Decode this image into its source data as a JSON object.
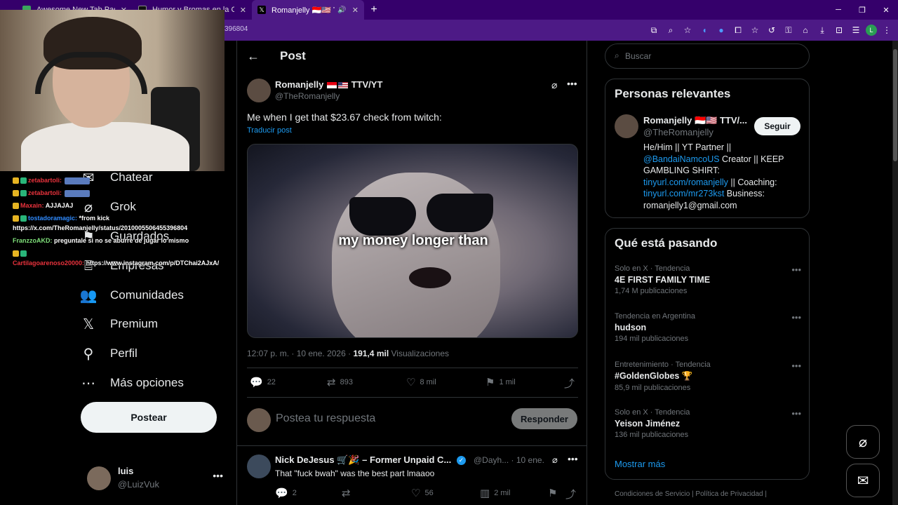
{
  "browser": {
    "tabs": [
      {
        "title": "Awesome New Tab Page",
        "active": false
      },
      {
        "title": "Humor y Bromas en la Calle co",
        "active": false
      },
      {
        "title": "Romanjelly 🇮🇩🇺🇸 TTV/YT en",
        "active": true
      }
    ],
    "url_fragment": "396804",
    "profile_initial": "L",
    "accent": "#4d1a86"
  },
  "chat": [
    {
      "user": "zetabartoli:",
      "text": "",
      "user_color": "red"
    },
    {
      "user": "zetabartoli:",
      "text": "",
      "user_color": "red"
    },
    {
      "user": "Maxain:",
      "text": "AJJAJAJ",
      "user_color": "red"
    },
    {
      "user": "tostadoramagic:",
      "text": "*from kick https://x.com/TheRomanjelly/status/2010005506455396804",
      "user_color": "blue"
    },
    {
      "user": "FranzzoAKD:",
      "text": "preguntale si no se aburre de jugar lo mismo",
      "user_color": "green"
    },
    {
      "user": "Cartilagoarenoso20000:",
      "text": "https://www.instagram.com/p/DTChai2AJxA/",
      "user_color": "red"
    }
  ],
  "nav": {
    "items": [
      {
        "label": "Chatear",
        "icon": "chat-icon"
      },
      {
        "label": "Grok",
        "icon": "grok-icon"
      },
      {
        "label": "Guardados",
        "icon": "bookmark-icon"
      },
      {
        "label": "Empresas",
        "icon": "briefcase-icon"
      },
      {
        "label": "Comunidades",
        "icon": "communities-icon"
      },
      {
        "label": "Premium",
        "icon": "x-logo-icon"
      },
      {
        "label": "Perfil",
        "icon": "person-icon"
      },
      {
        "label": "Más opciones",
        "icon": "more-circle-icon"
      }
    ],
    "post_button": "Postear",
    "account": {
      "name": "luis",
      "handle": "@LuizVuk"
    }
  },
  "main": {
    "header_title": "Post",
    "tweet": {
      "author_name": "Romanjelly",
      "author_suffix": "TTV/YT",
      "author_handle": "@TheRomanjelly",
      "text": "Me when I get that $23.67 check from twitch:",
      "translate": "Traducir post",
      "media_caption": "my money longer than",
      "time": "12:07 p. m. · 10 ene. 2026 ·",
      "views": "191,4 mil",
      "views_label": "Visualizaciones",
      "replies": "22",
      "reposts": "893",
      "likes": "8 mil",
      "bookmarks": "1 mil"
    },
    "reply_box": {
      "placeholder": "Postea tu respuesta",
      "button": "Responder"
    },
    "comment": {
      "name": "Nick DeJesus 🛒🎉 – Former Unpaid C...",
      "handle": "@Dayh... · 10 ene.",
      "text": "That \"fuck bwah\" was the best part lmaaoo",
      "replies": "2",
      "likes": "56",
      "views": "2 mil"
    }
  },
  "right": {
    "search_placeholder": "Buscar",
    "relevant": {
      "title": "Personas relevantes",
      "name": "Romanjelly 🇮🇩🇺🇸 TTV/...",
      "handle": "@TheRomanjelly",
      "follow": "Seguir",
      "bio_1": "He/Him || YT Partner ||",
      "bio_link_1": "@BandaiNamcoUS",
      "bio_2": " Creator || KEEP GAMBLING SHIRT:",
      "bio_link_2": "tinyurl.com/romanjelly",
      "bio_3": " || Coaching:",
      "bio_link_3": "tinyurl.com/mr273kst",
      "bio_4": " Business: romanjelly1@gmail.com"
    },
    "trends": {
      "title": "Qué está pasando",
      "items": [
        {
          "context": "Solo en X · Tendencia",
          "name": "4E FIRST FAMILY TIME",
          "count": "1,74 M publicaciones"
        },
        {
          "context": "Tendencia en Argentina",
          "name": "hudson",
          "count": "194 mil publicaciones"
        },
        {
          "context": "Entretenimiento · Tendencia",
          "name": "#GoldenGlobes 🏆",
          "count": "85,9 mil publicaciones"
        },
        {
          "context": "Solo en X · Tendencia",
          "name": "Yeison Jiménez",
          "count": "136 mil publicaciones"
        }
      ],
      "show_more": "Mostrar más"
    },
    "footer": "Condiciones de Servicio  |  Política de Privacidad  |"
  }
}
